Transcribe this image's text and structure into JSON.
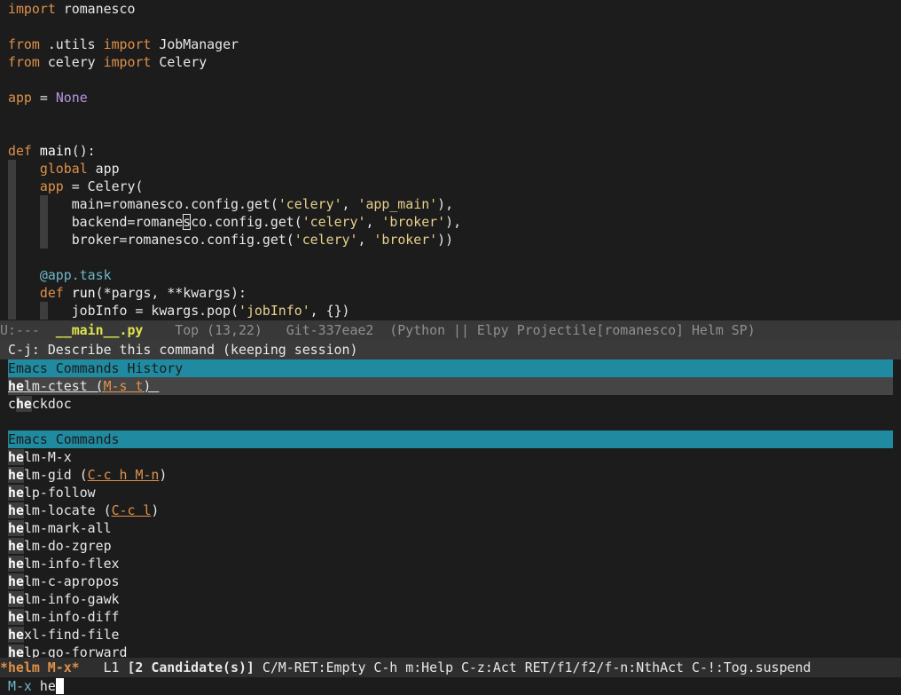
{
  "editor": {
    "code_lines": [
      {
        "parts": [
          {
            "t": "import",
            "c": "kw"
          },
          {
            "t": " romanesco",
            "c": ""
          }
        ]
      },
      {
        "parts": []
      },
      {
        "parts": [
          {
            "t": "from",
            "c": "kw"
          },
          {
            "t": " .utils ",
            "c": ""
          },
          {
            "t": "import",
            "c": "kw"
          },
          {
            "t": " JobManager",
            "c": ""
          }
        ]
      },
      {
        "parts": [
          {
            "t": "from",
            "c": "kw"
          },
          {
            "t": " celery ",
            "c": ""
          },
          {
            "t": "import",
            "c": "kw"
          },
          {
            "t": " Celery",
            "c": ""
          }
        ]
      },
      {
        "parts": []
      },
      {
        "parts": [
          {
            "t": "app",
            "c": "kw"
          },
          {
            "t": " = ",
            "c": ""
          },
          {
            "t": "None",
            "c": "none"
          }
        ]
      },
      {
        "parts": []
      },
      {
        "parts": []
      },
      {
        "parts": [
          {
            "t": "def",
            "c": "kw"
          },
          {
            "t": " main",
            "c": "fn"
          },
          {
            "t": "():",
            "c": ""
          }
        ]
      },
      {
        "parts": [
          {
            "t": "    ",
            "c": ""
          },
          {
            "t": "global",
            "c": "kw"
          },
          {
            "t": " app",
            "c": ""
          }
        ]
      },
      {
        "parts": [
          {
            "t": "    ",
            "c": ""
          },
          {
            "t": "app",
            "c": "kw"
          },
          {
            "t": " = Celery(",
            "c": ""
          }
        ]
      },
      {
        "parts": [
          {
            "t": "        main=romanesco.config.get(",
            "c": ""
          },
          {
            "t": "'celery'",
            "c": "str"
          },
          {
            "t": ", ",
            "c": ""
          },
          {
            "t": "'app_main'",
            "c": "str"
          },
          {
            "t": "),",
            "c": ""
          }
        ]
      },
      {
        "parts": [
          {
            "t": "        backend=romane",
            "c": ""
          },
          {
            "t": "s",
            "c": "cur"
          },
          {
            "t": "co.config.get(",
            "c": ""
          },
          {
            "t": "'celery'",
            "c": "str"
          },
          {
            "t": ", ",
            "c": ""
          },
          {
            "t": "'broker'",
            "c": "str"
          },
          {
            "t": "),",
            "c": ""
          }
        ]
      },
      {
        "parts": [
          {
            "t": "        broker=romanesco.config.get(",
            "c": ""
          },
          {
            "t": "'celery'",
            "c": "str"
          },
          {
            "t": ", ",
            "c": ""
          },
          {
            "t": "'broker'",
            "c": "str"
          },
          {
            "t": "))",
            "c": ""
          }
        ]
      },
      {
        "parts": []
      },
      {
        "parts": [
          {
            "t": "    ",
            "c": ""
          },
          {
            "t": "@app.task",
            "c": "deco"
          }
        ]
      },
      {
        "parts": [
          {
            "t": "    ",
            "c": ""
          },
          {
            "t": "def",
            "c": "kw"
          },
          {
            "t": " run",
            "c": "fn"
          },
          {
            "t": "(*pargs, **kwargs):",
            "c": ""
          }
        ]
      },
      {
        "parts": [
          {
            "t": "        jobInfo = kwargs.pop(",
            "c": ""
          },
          {
            "t": "'jobInfo'",
            "c": "str"
          },
          {
            "t": ", {})",
            "c": ""
          }
        ]
      }
    ]
  },
  "modeline": {
    "state": "U:---  ",
    "filename": "__main__.py",
    "rest": "    Top (13,22)   Git-337eae2  (Python || Elpy Projectile[romanesco] Helm SP)"
  },
  "helm": {
    "hint": "C-j: Describe this command (keeping session)",
    "history_header": "Emacs Commands History",
    "history": [
      {
        "pre": "",
        "match": "he",
        "post": "lm-ctest (",
        "key": "M-s t",
        "end": ") "
      },
      {
        "pre": "c",
        "match": "he",
        "post": "ckdoc",
        "key": "",
        "end": ""
      }
    ],
    "commands_header": "Emacs Commands",
    "commands": [
      {
        "match": "he",
        "post": "lm-M-x",
        "key": "",
        "end": ""
      },
      {
        "match": "he",
        "post": "lm-gid (",
        "key": "C-c h M-n",
        "end": ")"
      },
      {
        "match": "he",
        "post": "lp-follow",
        "key": "",
        "end": ""
      },
      {
        "match": "he",
        "post": "lm-locate (",
        "key": "C-c l",
        "end": ")"
      },
      {
        "match": "he",
        "post": "lm-mark-all",
        "key": "",
        "end": ""
      },
      {
        "match": "he",
        "post": "lm-do-zgrep",
        "key": "",
        "end": ""
      },
      {
        "match": "he",
        "post": "lm-info-flex",
        "key": "",
        "end": ""
      },
      {
        "match": "he",
        "post": "lm-c-apropos",
        "key": "",
        "end": ""
      },
      {
        "match": "he",
        "post": "lm-info-gawk",
        "key": "",
        "end": ""
      },
      {
        "match": "he",
        "post": "lm-info-diff",
        "key": "",
        "end": ""
      },
      {
        "match": "he",
        "post": "xl-find-file",
        "key": "",
        "end": ""
      },
      {
        "match": "he",
        "post": "lp-go-forward",
        "key": "",
        "end": ""
      }
    ],
    "modeline": {
      "name": "*helm M-x*",
      "line": "   L1 ",
      "candidates": "[2 Candidate(s)]",
      "help": " C/M-RET:Empty C-h m:Help C-z:Act RET/f1/f2/f-n:NthAct C-!:Tog.suspend"
    }
  },
  "minibuffer": {
    "prompt": "M-x ",
    "input": "he"
  },
  "colors": {
    "background": "#1c1c1c",
    "keyword": "#e0914b",
    "helm_header": "#208aa0",
    "modeline_file": "#dfe34b"
  }
}
